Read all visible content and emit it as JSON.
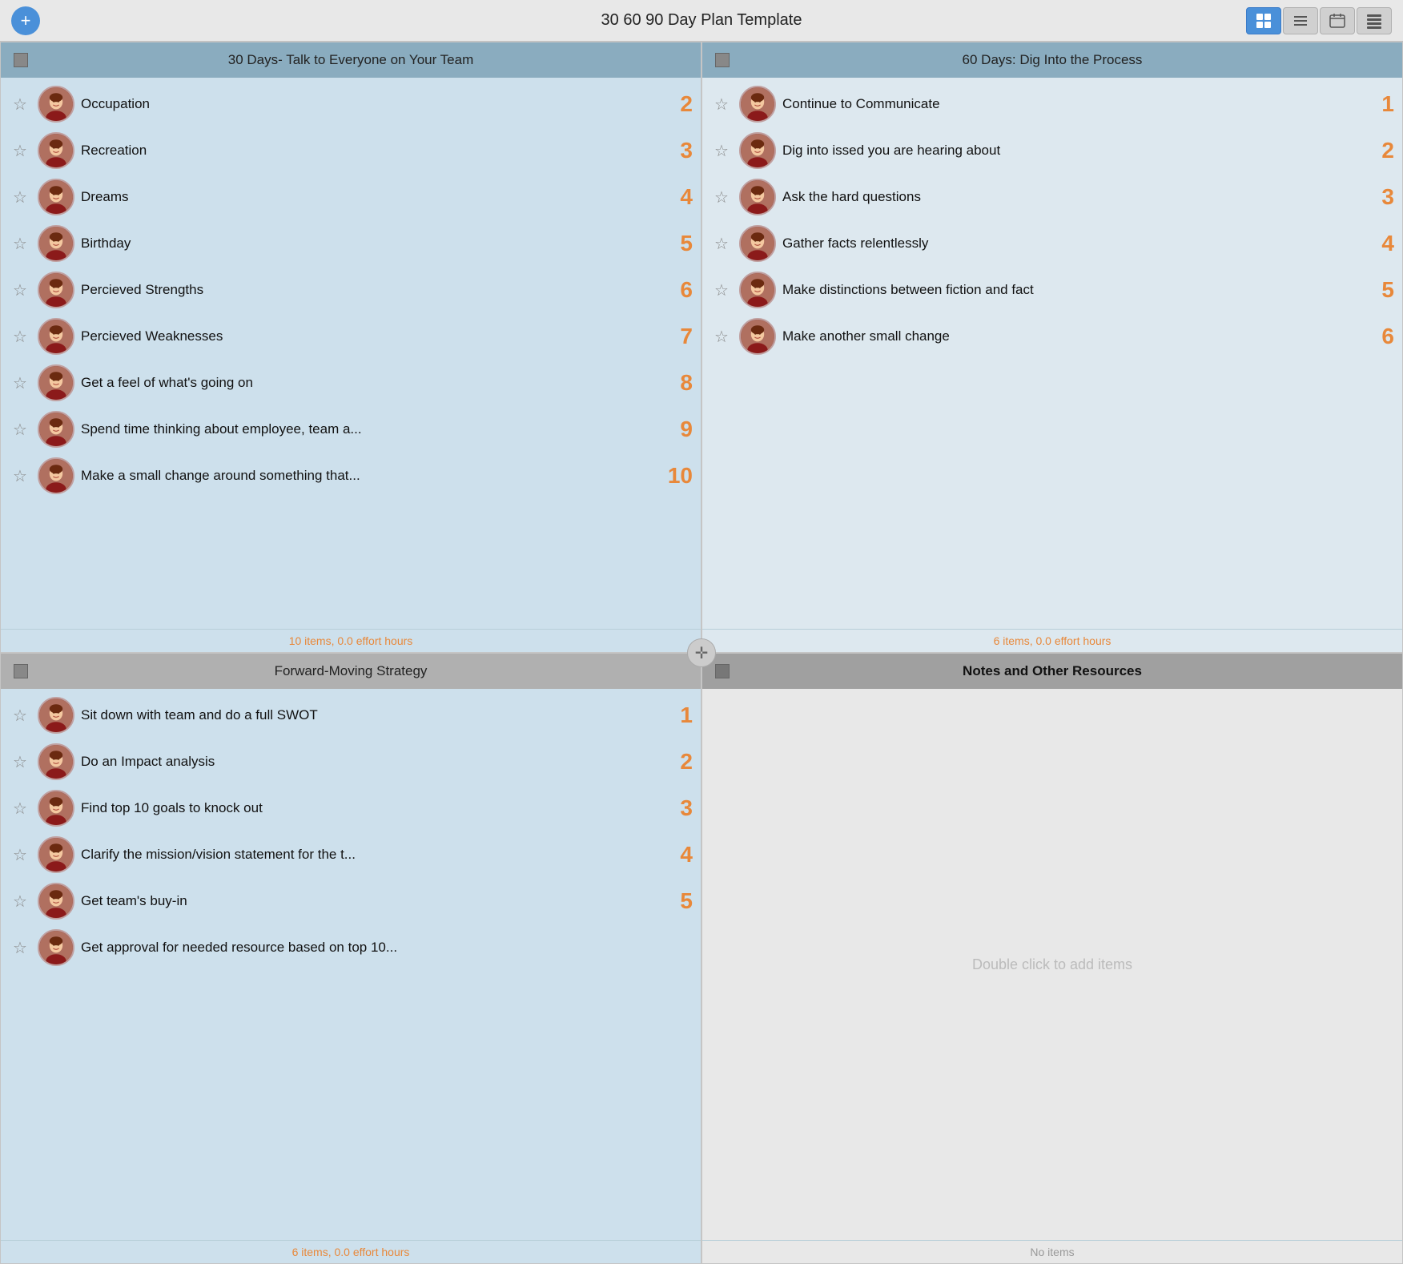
{
  "titleBar": {
    "title": "30 60 90 Day Plan Template",
    "addButton": "+",
    "toolbarButtons": [
      {
        "icon": "⊞",
        "label": "grid-view",
        "active": true
      },
      {
        "icon": "≡",
        "label": "list-view",
        "active": false
      },
      {
        "icon": "⊡",
        "label": "calendar-view",
        "active": false
      },
      {
        "icon": "☰",
        "label": "detail-view",
        "active": false
      }
    ]
  },
  "quadrants": [
    {
      "id": "q1",
      "header": "30 Days- Talk to Everyone on Your Team",
      "headerStyle": "blue",
      "bodyStyle": "blue",
      "items": [
        {
          "label": "Occupation",
          "number": "2"
        },
        {
          "label": "Recreation",
          "number": "3"
        },
        {
          "label": "Dreams",
          "number": "4"
        },
        {
          "label": "Birthday",
          "number": "5"
        },
        {
          "label": "Percieved Strengths",
          "number": "6"
        },
        {
          "label": "Percieved Weaknesses",
          "number": "7"
        },
        {
          "label": "Get a feel of what's going on",
          "number": "8"
        },
        {
          "label": "Spend time thinking about employee, team a...",
          "number": "9"
        },
        {
          "label": "Make a small change around something that...",
          "number": "10"
        }
      ],
      "footer": "10 items, 0.0 effort hours"
    },
    {
      "id": "q2",
      "header": "60 Days: Dig Into the Process",
      "headerStyle": "blue",
      "bodyStyle": "light-gray",
      "items": [
        {
          "label": "Continue to Communicate",
          "number": "1"
        },
        {
          "label": "Dig into issed you are hearing about",
          "number": "2"
        },
        {
          "label": "Ask the hard questions",
          "number": "3"
        },
        {
          "label": "Gather facts relentlessly",
          "number": "4"
        },
        {
          "label": "Make distinctions between fiction and fact",
          "number": "5"
        },
        {
          "label": "Make another small change",
          "number": "6"
        }
      ],
      "footer": "6 items, 0.0 effort hours"
    },
    {
      "id": "q3",
      "header": "Forward-Moving Strategy",
      "headerStyle": "gray",
      "bodyStyle": "blue",
      "items": [
        {
          "label": "Sit down with team and do a full SWOT",
          "number": "1"
        },
        {
          "label": "Do an Impact analysis",
          "number": "2"
        },
        {
          "label": "Find top 10 goals to knock out",
          "number": "3"
        },
        {
          "label": "Clarify the mission/vision statement for the t...",
          "number": "4"
        },
        {
          "label": "Get team's buy-in",
          "number": "5"
        },
        {
          "label": "Get approval for needed resource based on top 10...",
          "number": ""
        }
      ],
      "footer": "6 items, 0.0 effort hours"
    },
    {
      "id": "q4",
      "header": "Notes and Other Resources",
      "headerStyle": "dark-gray",
      "bodyStyle": "notes",
      "items": [],
      "placeholder": "Double click to add items",
      "footer": "No items"
    }
  ],
  "divider": {
    "icon": "✛"
  }
}
